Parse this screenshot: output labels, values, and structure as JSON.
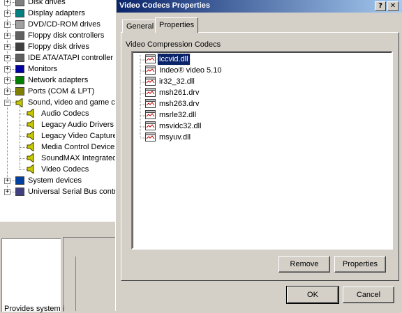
{
  "device_manager": {
    "items": [
      {
        "label": "Disk drives",
        "icon": "disk-drive-icon",
        "expander": "+"
      },
      {
        "label": "Display adapters",
        "icon": "display-adapter-icon",
        "expander": "+"
      },
      {
        "label": "DVD/CD-ROM drives",
        "icon": "cdrom-icon",
        "expander": "+"
      },
      {
        "label": "Floppy disk controllers",
        "icon": "floppy-controller-icon",
        "expander": "+"
      },
      {
        "label": "Floppy disk drives",
        "icon": "floppy-drive-icon",
        "expander": "+"
      },
      {
        "label": "IDE ATA/ATAPI controller",
        "icon": "ide-controller-icon",
        "expander": "+"
      },
      {
        "label": "Monitors",
        "icon": "monitor-icon",
        "expander": "+"
      },
      {
        "label": "Network adapters",
        "icon": "network-adapter-icon",
        "expander": "+"
      },
      {
        "label": "Ports (COM & LPT)",
        "icon": "port-icon",
        "expander": "+"
      },
      {
        "label": "Sound, video and game c",
        "icon": "speaker-icon",
        "expander": "−"
      },
      {
        "label": "System devices",
        "icon": "system-device-icon",
        "expander": "+"
      },
      {
        "label": "Universal Serial Bus contr",
        "icon": "usb-icon",
        "expander": "+"
      }
    ],
    "sound_children": [
      "Audio Codecs",
      "Legacy Audio Drivers",
      "Legacy Video Capture",
      "Media Control Devices",
      "SoundMAX Integrated",
      "Video Codecs"
    ],
    "description": "Provides system i"
  },
  "dialog": {
    "title": "Video Codecs Properties",
    "help_button": "?",
    "close_button": "✕",
    "tabs": [
      "General",
      "Properties"
    ],
    "active_tab": "Properties",
    "group_label": "Video Compression Codecs",
    "codecs": [
      {
        "label": "iccvid.dll",
        "selected": true
      },
      {
        "label": "Indeo® video 5.10",
        "selected": false
      },
      {
        "label": "ir32_32.dll",
        "selected": false
      },
      {
        "label": "msh261.drv",
        "selected": false
      },
      {
        "label": "msh263.drv",
        "selected": false
      },
      {
        "label": "msrle32.dll",
        "selected": false
      },
      {
        "label": "msvidc32.dll",
        "selected": false
      },
      {
        "label": "msyuv.dll",
        "selected": false
      }
    ],
    "remove_label": "Remove",
    "properties_label": "Properties",
    "ok_label": "OK",
    "cancel_label": "Cancel"
  }
}
